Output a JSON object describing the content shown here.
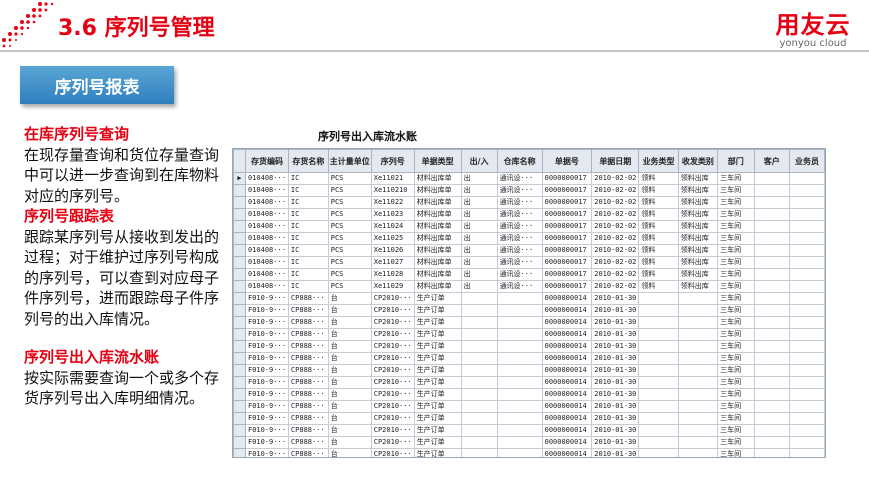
{
  "header": {
    "title": "3.6 序列号管理",
    "brand_name": "用友云",
    "brand_sub": "yonyou cloud"
  },
  "section_badge": "序列号报表",
  "left_panel": [
    {
      "heading": "在库序列号查询",
      "body": "在现存量查询和货位存量查询中可以进一步查询到在库物料对应的序列号。"
    },
    {
      "heading": "序列号跟踪表",
      "body": "跟踪某序列号从接收到发出的过程；对于维护过序列号构成的序列号，可以查到对应母子件序列号，进而跟踪母子件序列号的出入库情况。"
    },
    {
      "heading": "序列号出入库流水账",
      "body": "按实际需要查询一个或多个存货序列号出入库明细情况。"
    }
  ],
  "report": {
    "title": "序列号出入库流水账",
    "columns": [
      "存货编码",
      "存货名称",
      "主计量单位",
      "序列号",
      "单据类型",
      "出/入",
      "仓库名称",
      "单据号",
      "单据日期",
      "业务类型",
      "收发类别",
      "部门",
      "客户",
      "业务员"
    ],
    "selected_row_marker": "▶",
    "rows": [
      [
        "010408···",
        "IC",
        "PCS",
        "Xe11021",
        "材料出库单",
        "出",
        "通讯设···",
        "0000000017",
        "2010-02-02",
        "领料",
        "领料出库",
        "三车间",
        "",
        ""
      ],
      [
        "010408···",
        "IC",
        "PCS",
        "Xe110210",
        "材料出库单",
        "出",
        "通讯设···",
        "0000000017",
        "2010-02-02",
        "领料",
        "领料出库",
        "三车间",
        "",
        ""
      ],
      [
        "010408···",
        "IC",
        "PCS",
        "Xe11022",
        "材料出库单",
        "出",
        "通讯设···",
        "0000000017",
        "2010-02-02",
        "领料",
        "领料出库",
        "三车间",
        "",
        ""
      ],
      [
        "010408···",
        "IC",
        "PCS",
        "Xe11023",
        "材料出库单",
        "出",
        "通讯设···",
        "0000000017",
        "2010-02-02",
        "领料",
        "领料出库",
        "三车间",
        "",
        ""
      ],
      [
        "010408···",
        "IC",
        "PCS",
        "Xe11024",
        "材料出库单",
        "出",
        "通讯设···",
        "0000000017",
        "2010-02-02",
        "领料",
        "领料出库",
        "三车间",
        "",
        ""
      ],
      [
        "010408···",
        "IC",
        "PCS",
        "Xe11025",
        "材料出库单",
        "出",
        "通讯设···",
        "0000000017",
        "2010-02-02",
        "领料",
        "领料出库",
        "三车间",
        "",
        ""
      ],
      [
        "010408···",
        "IC",
        "PCS",
        "Xe11026",
        "材料出库单",
        "出",
        "通讯设···",
        "0000000017",
        "2010-02-02",
        "领料",
        "领料出库",
        "三车间",
        "",
        ""
      ],
      [
        "010408···",
        "IC",
        "PCS",
        "Xe11027",
        "材料出库单",
        "出",
        "通讯设···",
        "0000000017",
        "2010-02-02",
        "领料",
        "领料出库",
        "三车间",
        "",
        ""
      ],
      [
        "010408···",
        "IC",
        "PCS",
        "Xe11028",
        "材料出库单",
        "出",
        "通讯设···",
        "0000000017",
        "2010-02-02",
        "领料",
        "领料出库",
        "三车间",
        "",
        ""
      ],
      [
        "010408···",
        "IC",
        "PCS",
        "Xe11029",
        "材料出库单",
        "出",
        "通讯设···",
        "0000000017",
        "2010-02-02",
        "领料",
        "领料出库",
        "三车间",
        "",
        ""
      ],
      [
        "F010-9···",
        "CP888···",
        "台",
        "CP2010···",
        "生产订单",
        "",
        "",
        "0000000014",
        "2010-01-30",
        "",
        "",
        "三车间",
        "",
        ""
      ],
      [
        "F010-9···",
        "CP888···",
        "台",
        "CP2010···",
        "生产订单",
        "",
        "",
        "0000000014",
        "2010-01-30",
        "",
        "",
        "三车间",
        "",
        ""
      ],
      [
        "F010-9···",
        "CP888···",
        "台",
        "CP2010···",
        "生产订单",
        "",
        "",
        "0000000014",
        "2010-01-30",
        "",
        "",
        "三车间",
        "",
        ""
      ],
      [
        "F010-9···",
        "CP888···",
        "台",
        "CP2010···",
        "生产订单",
        "",
        "",
        "0000000014",
        "2010-01-30",
        "",
        "",
        "三车间",
        "",
        ""
      ],
      [
        "F010-9···",
        "CP888···",
        "台",
        "CP2010···",
        "生产订单",
        "",
        "",
        "0000000014",
        "2010-01-30",
        "",
        "",
        "三车间",
        "",
        ""
      ],
      [
        "F010-9···",
        "CP888···",
        "台",
        "CP2010···",
        "生产订单",
        "",
        "",
        "0000000014",
        "2010-01-30",
        "",
        "",
        "三车间",
        "",
        ""
      ],
      [
        "F010-9···",
        "CP888···",
        "台",
        "CP2010···",
        "生产订单",
        "",
        "",
        "0000000014",
        "2010-01-30",
        "",
        "",
        "三车间",
        "",
        ""
      ],
      [
        "F010-9···",
        "CP888···",
        "台",
        "CP2010···",
        "生产订单",
        "",
        "",
        "0000000014",
        "2010-01-30",
        "",
        "",
        "三车间",
        "",
        ""
      ],
      [
        "F010-9···",
        "CP888···",
        "台",
        "CP2010···",
        "生产订单",
        "",
        "",
        "0000000014",
        "2010-01-30",
        "",
        "",
        "三车间",
        "",
        ""
      ],
      [
        "F010-9···",
        "CP888···",
        "台",
        "CP2010···",
        "生产订单",
        "",
        "",
        "0000000014",
        "2010-01-30",
        "",
        "",
        "三车间",
        "",
        ""
      ],
      [
        "F010-9···",
        "CP888···",
        "台",
        "CP2010···",
        "生产订单",
        "",
        "",
        "0000000014",
        "2010-01-30",
        "",
        "",
        "三车间",
        "",
        ""
      ],
      [
        "F010-9···",
        "CP888···",
        "台",
        "CP2010···",
        "生产订单",
        "",
        "",
        "0000000014",
        "2010-01-30",
        "",
        "",
        "三车间",
        "",
        ""
      ],
      [
        "F010-9···",
        "CP888···",
        "台",
        "CP2010···",
        "生产订单",
        "",
        "",
        "0000000014",
        "2010-01-30",
        "",
        "",
        "三车间",
        "",
        ""
      ],
      [
        "F010-9···",
        "CP888···",
        "台",
        "CP2010···",
        "生产订单",
        "",
        "",
        "0000000014",
        "2010-01-30",
        "",
        "",
        "三车间",
        "",
        ""
      ]
    ]
  }
}
